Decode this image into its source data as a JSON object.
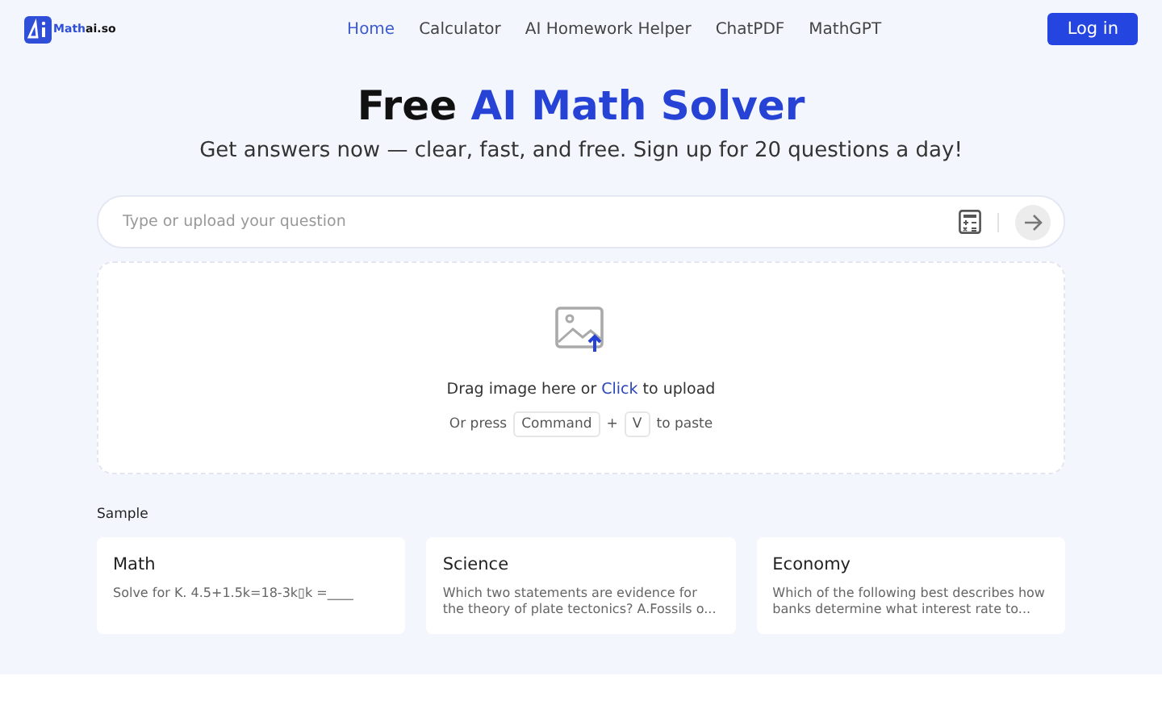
{
  "header": {
    "logo": {
      "part1": "Math",
      "part2": "ai.so"
    },
    "nav": [
      {
        "label": "Home",
        "selected": true
      },
      {
        "label": "Calculator",
        "selected": false
      },
      {
        "label": "AI Homework Helper",
        "selected": false
      },
      {
        "label": "ChatPDF",
        "selected": false
      },
      {
        "label": "MathGPT",
        "selected": false
      }
    ],
    "login": "Log in"
  },
  "hero": {
    "title_plain": "Free",
    "title_accent": "AI Math Solver",
    "subtitle": "Get answers now — clear, fast, and free. Sign up for 20 questions a day!"
  },
  "search": {
    "placeholder": "Type or upload your question"
  },
  "upload": {
    "before": "Drag image here or",
    "link": "Click",
    "after": "to upload",
    "paste_before": "Or press",
    "keys": [
      "Command",
      "V"
    ],
    "plus": "+",
    "paste_after": "to paste"
  },
  "samples": {
    "heading": "Sample",
    "cards": [
      {
        "title": "Math",
        "text": "Solve for K. 4.5+1.5k=18-3k▯k =____"
      },
      {
        "title": "Science",
        "text": "Which two statements are evidence for the theory of plate tectonics? A.Fossils o..."
      },
      {
        "title": "Economy",
        "text": "Which of the following best describes how banks determine what interest rate to..."
      }
    ]
  }
}
